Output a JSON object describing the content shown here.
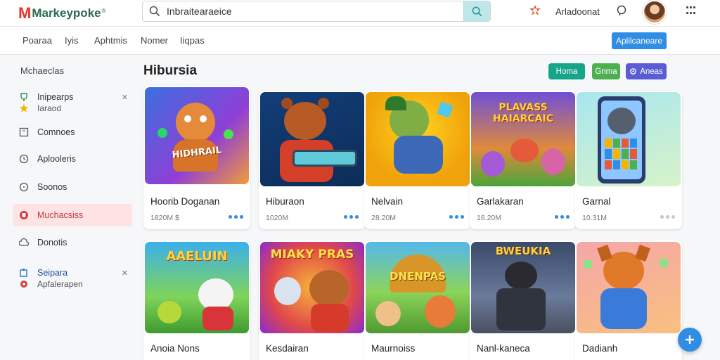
{
  "app": {
    "logo_mark": "M",
    "logo_text": "Markeypoke",
    "logo_tm": "®"
  },
  "search": {
    "value": "Inbraitearaeice",
    "placeholder": ""
  },
  "header": {
    "account_label": "Arladoonat"
  },
  "nav": {
    "items": [
      "Poaraa",
      "Iyis",
      "Aphtmis",
      "Nomer",
      "Iiqpas"
    ],
    "cta_label": "Aplilcaneare"
  },
  "sidebar": {
    "heading": "Mchaeclas",
    "items": [
      {
        "label": "Inipearps",
        "sub": "Iaraod",
        "icon": "trophy-icon",
        "expand": "✕"
      },
      {
        "label": "Comnoes",
        "icon": "box-icon"
      },
      {
        "label": "Aplooleris",
        "icon": "clock-icon"
      },
      {
        "label": "Soonos",
        "icon": "circle-icon"
      },
      {
        "label": "Muchacsiss",
        "icon": "shield-icon"
      },
      {
        "label": "Donotis",
        "icon": "cloud-icon"
      },
      {
        "label": "Seipara",
        "sub": "Apfalerapen",
        "icon": "puzzle-icon",
        "expand": "✕"
      }
    ]
  },
  "main": {
    "title": "Hibursia",
    "filters": [
      {
        "label": "Homa",
        "color": "#17a589"
      },
      {
        "label": "Gnma",
        "color": "#4caf50"
      },
      {
        "label": "Aneas",
        "icon": "settings-icon",
        "color": "#5b5bd6"
      }
    ],
    "cards": [
      {
        "title": "Hoorib  Doganan",
        "meta": "1820M  $",
        "art_text": "HIDHRAIL",
        "dots": "blue"
      },
      {
        "title": "Hiburaon",
        "meta": "1020M",
        "art_text": "",
        "dots": "blue"
      },
      {
        "title": "Nelvain",
        "meta": "28.20M",
        "art_text": "",
        "dots": "blue"
      },
      {
        "title": "Garlakaran",
        "meta": "16.20M",
        "art_text": "PLAVASS HAIARCAIC",
        "dots": "blue"
      },
      {
        "title": "Garnal",
        "meta": "10.31M",
        "art_text": "",
        "dots": "grey"
      },
      {
        "title": "Anoia  Nons",
        "meta": "",
        "art_text": "AAELUIN",
        "dots": "blue"
      },
      {
        "title": "Kesdairan",
        "meta": "",
        "art_text": "MIAKY PRAS",
        "dots": "blue"
      },
      {
        "title": "Maurnoiss",
        "meta": "",
        "art_text": "DNENPAS",
        "dots": "blue"
      },
      {
        "title": "Nanl-kaneca",
        "meta": "",
        "art_text": "BWEUKIA",
        "dots": "blue"
      },
      {
        "title": "Dadianh",
        "meta": "",
        "art_text": "",
        "dots": "blue"
      }
    ]
  },
  "colors": {
    "accent": "#2f8de4",
    "logo_red": "#e2382a",
    "active_bg": "#fde3e3"
  }
}
